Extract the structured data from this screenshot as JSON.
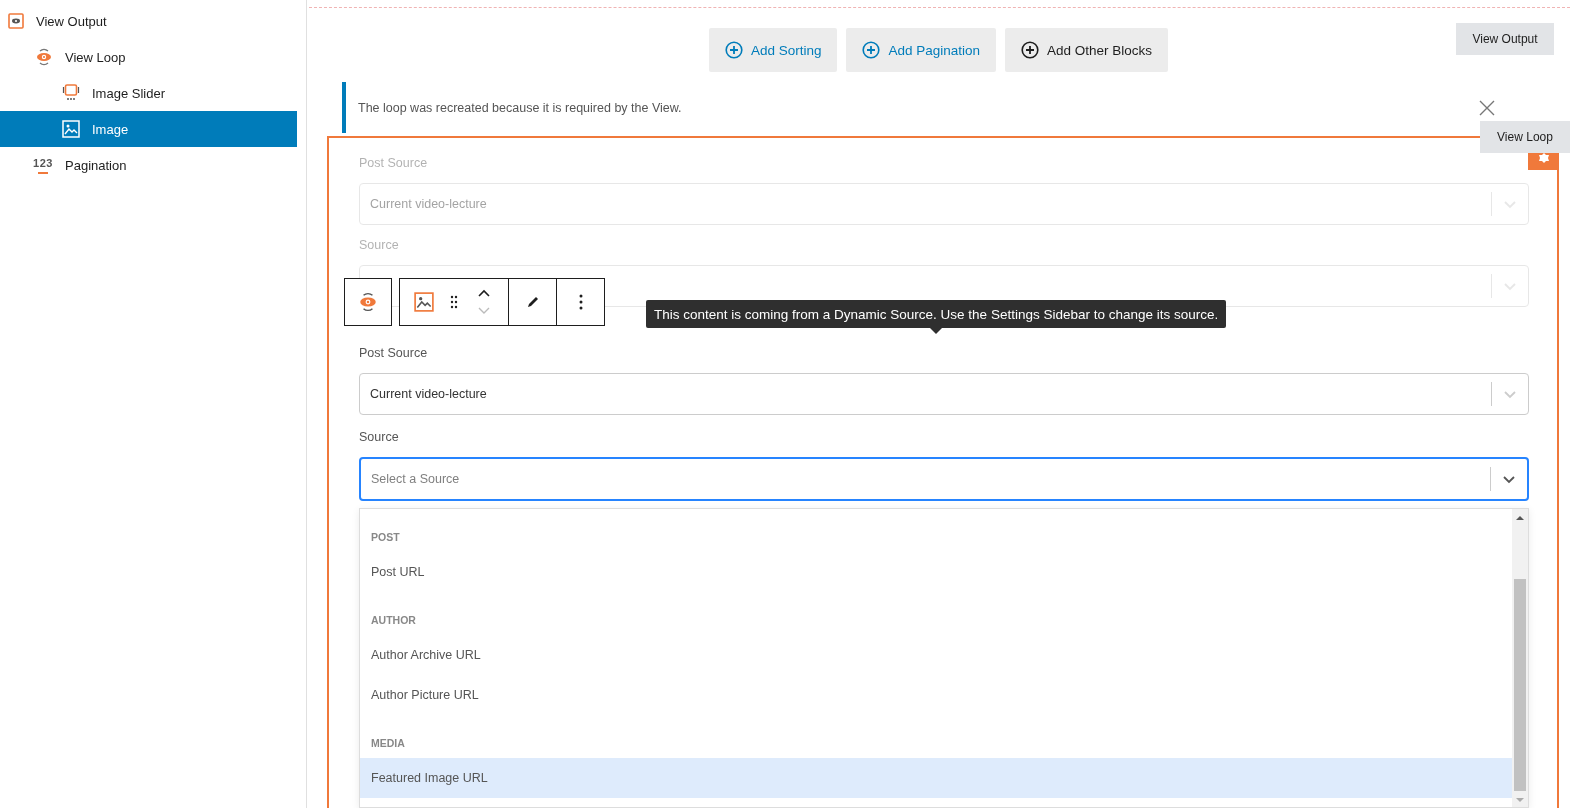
{
  "sidebar": {
    "items": [
      {
        "label": "View Output",
        "kind": "output",
        "selected": false,
        "children": [
          {
            "label": "View Loop",
            "kind": "loop",
            "selected": false,
            "children": [
              {
                "label": "Image Slider",
                "kind": "slider",
                "selected": false
              },
              {
                "label": "Image",
                "kind": "image",
                "selected": true
              }
            ]
          },
          {
            "label": "Pagination",
            "kind": "pagination",
            "icon_text": "123",
            "selected": false
          }
        ]
      }
    ]
  },
  "add_buttons": [
    {
      "label": "Add Sorting",
      "kind": "accent"
    },
    {
      "label": "Add Pagination",
      "kind": "accent"
    },
    {
      "label": "Add Other Blocks",
      "kind": "plain"
    }
  ],
  "floating_labels": {
    "view_output": "View Output",
    "view_loop": "View Loop"
  },
  "notice": {
    "text": "The loop was recreated because it is required by the View."
  },
  "block": {
    "faded_fields": [
      {
        "label": "Post Source",
        "value": "Current video-lecture"
      },
      {
        "label": "Source"
      }
    ],
    "tooltip": "This content is coming from a Dynamic Source. Use the Settings Sidebar to change its source.",
    "post_source": {
      "label": "Post Source",
      "value": "Current video-lecture"
    },
    "source": {
      "label": "Source",
      "placeholder": "Select a Source",
      "focused": true
    },
    "dropdown": {
      "groups": [
        {
          "heading": "POST",
          "options": [
            {
              "label": "Post URL",
              "selected": false
            }
          ]
        },
        {
          "heading": "AUTHOR",
          "options": [
            {
              "label": "Author Archive URL",
              "selected": false
            },
            {
              "label": "Author Picture URL",
              "selected": false
            }
          ]
        },
        {
          "heading": "MEDIA",
          "options": [
            {
              "label": "Featured Image URL",
              "selected": true
            }
          ]
        }
      ]
    }
  }
}
